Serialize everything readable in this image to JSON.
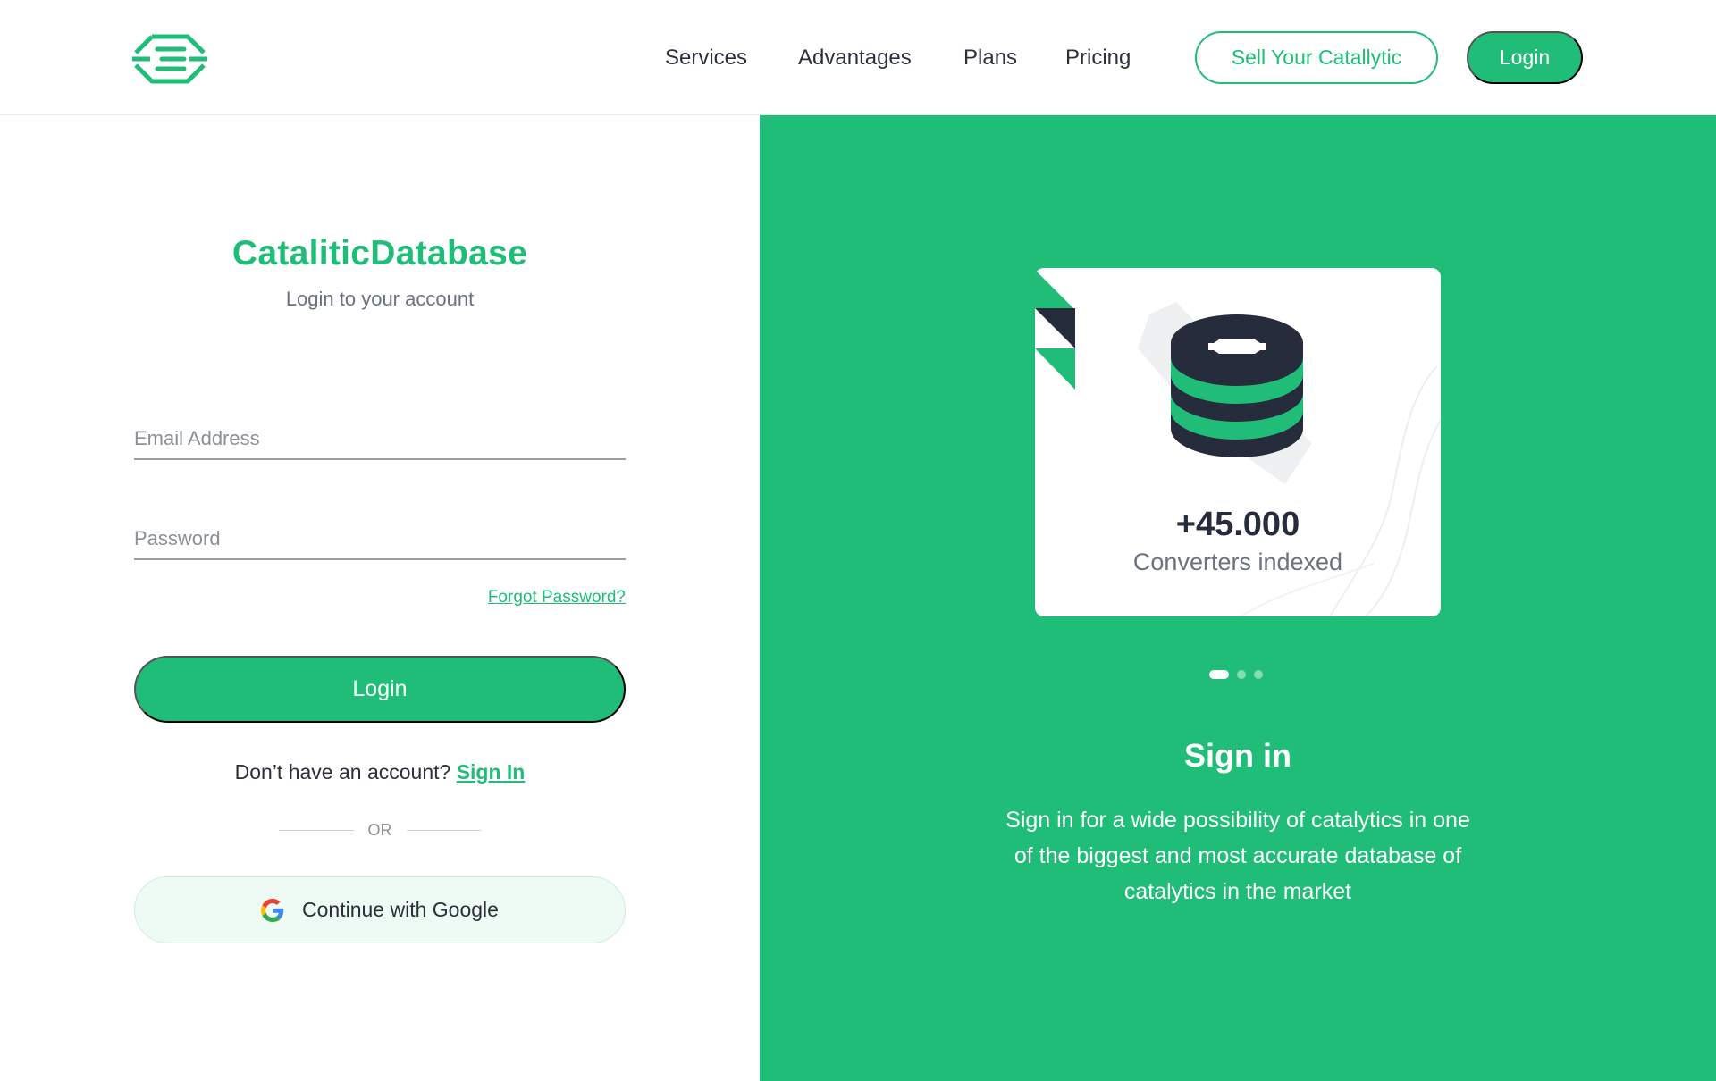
{
  "header": {
    "nav": [
      "Services",
      "Advantages",
      "Plans",
      "Pricing"
    ],
    "sell_button": "Sell Your Catallytic",
    "login_button": "Login"
  },
  "login_form": {
    "brand": "CataliticDatabase",
    "subtitle": "Login to your account",
    "email_placeholder": "Email Address",
    "password_placeholder": "Password",
    "forgot_link": "Forgot Password?",
    "submit": "Login",
    "no_account": "Don’t have an account?",
    "sign_in_link": "Sign In",
    "or": "OR",
    "google_button": "Continue with Google"
  },
  "promo": {
    "stat_value": "+45.000",
    "stat_label": "Converters indexed",
    "slides": 3,
    "active_slide": 1,
    "title": "Sign in",
    "description": "Sign in for a wide possibility of catalytics in one of the biggest and most accurate database of catalytics in the market"
  },
  "colors": {
    "accent": "#1fbd77",
    "dark": "#262c3b"
  }
}
